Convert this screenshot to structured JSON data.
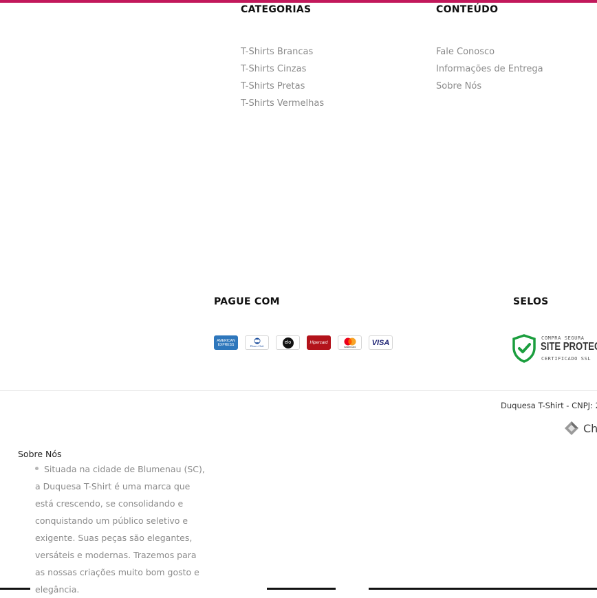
{
  "categorias": {
    "heading": "CATEGORIAS",
    "items": [
      "T-Shirts Brancas",
      "T-Shirts Cinzas",
      "T-Shirts Pretas",
      "T-Shirts Vermelhas"
    ]
  },
  "conteudo": {
    "heading": "CONTEÚDO",
    "items": [
      "Fale Conosco",
      "Informações de Entrega",
      "Sobre Nós"
    ]
  },
  "pague": {
    "heading": "PAGUE COM",
    "cards": [
      {
        "name": "american-express",
        "label_top": "AMERICAN",
        "label_bottom": "EXPRESS"
      },
      {
        "name": "diners-club",
        "label": "Diners Club"
      },
      {
        "name": "elo",
        "label": "elo"
      },
      {
        "name": "hipercard",
        "label": "Hipercard"
      },
      {
        "name": "mastercard",
        "label": "mastercard"
      },
      {
        "name": "visa",
        "label": "VISA"
      }
    ]
  },
  "selos": {
    "heading": "SELOS",
    "seal_top": "COMPRA SEGURA",
    "seal_main": "SITE PROTEGIDO",
    "seal_bottom": "CERTIFICADO SSL"
  },
  "footer": {
    "copyright": "Duquesa T-Shirt - CNPJ: 2",
    "developer": "Chi"
  },
  "about": {
    "title": "Sobre Nós",
    "text": "Situada na cidade de Blumenau (SC), a Duquesa T-Shirt é uma marca que está crescendo, se consolidando e conquistando um público seletivo e exigente. Suas peças são elegantes, versáteis e modernas. Trazemos para as nossas criações muito bom gosto e elegância."
  },
  "colors": {
    "accent": "#c2185b",
    "link": "#8a8a8a",
    "seal_green": "#1b9e3e"
  }
}
